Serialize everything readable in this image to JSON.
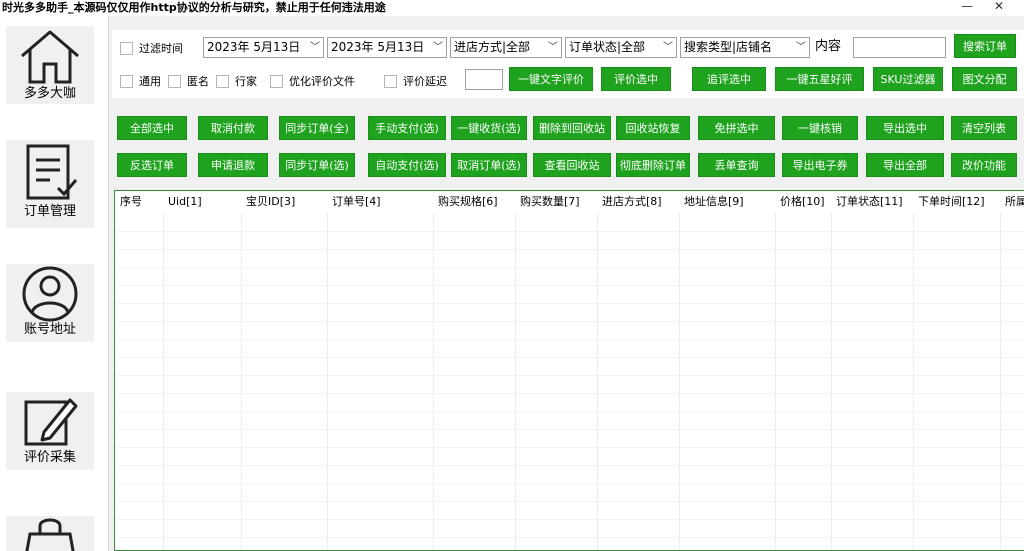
{
  "window": {
    "title": "时光多多助手_本源码仅仅用作http协议的分析与研究，禁止用于任何违法用途",
    "minimize_symbol": "—",
    "close_symbol": "✕"
  },
  "sidebar": {
    "items": [
      {
        "label": "多多大咖",
        "icon": "home-icon"
      },
      {
        "label": "订单管理",
        "icon": "order-list-icon"
      },
      {
        "label": "账号地址",
        "icon": "user-icon"
      },
      {
        "label": "评价采集",
        "icon": "edit-icon"
      },
      {
        "label": "",
        "icon": "shopping-bag-icon"
      }
    ]
  },
  "filters": {
    "filter_time_label": "过滤时间",
    "date_from": "2023年  5月13日",
    "date_to": "2023年  5月13日",
    "store_mode": "进店方式|全部",
    "order_status": "订单状态|全部",
    "search_type": "搜索类型|店铺名",
    "content_label": "内容",
    "content_value": "",
    "search_button": "搜索订单",
    "general_label": "通用",
    "anonymous_label": "匿名",
    "expert_label": "行家",
    "optimize_label": "优化评价文件",
    "review_delay_label": "评价延迟",
    "review_delay_value": "",
    "row2_buttons": [
      "一键文字评价",
      "评价选中",
      "追评选中",
      "一键五星好评",
      "SKU过滤器",
      "图文分配"
    ]
  },
  "actions": {
    "row1": [
      "全部选中",
      "取消付款",
      "同步订单(全)",
      "手动支付(选)",
      "一键收货(选)",
      "删除到回收站",
      "回收站恢复",
      "免拼选中",
      "一键核销",
      "导出选中",
      "清空列表"
    ],
    "row2": [
      "反选订单",
      "申请退款",
      "同步订单(选)",
      "自动支付(选)",
      "取消订单(选)",
      "查看回收站",
      "彻底删除订单",
      "丢单查询",
      "导出电子券",
      "导出全部",
      "改价功能"
    ]
  },
  "table": {
    "columns": [
      "序号",
      "Uid[1]",
      "宝贝ID[3]",
      "订单号[4]",
      "购买规格[6]",
      "购买数量[7]",
      "进店方式[8]",
      "地址信息[9]",
      "价格[10]",
      "订单状态[11]",
      "下单时间[12]",
      "所属"
    ],
    "rows": []
  },
  "colors": {
    "accent_green": "#1fa31f",
    "table_border": "#3a8a3a",
    "panel_bg": "#f0f0f0"
  }
}
